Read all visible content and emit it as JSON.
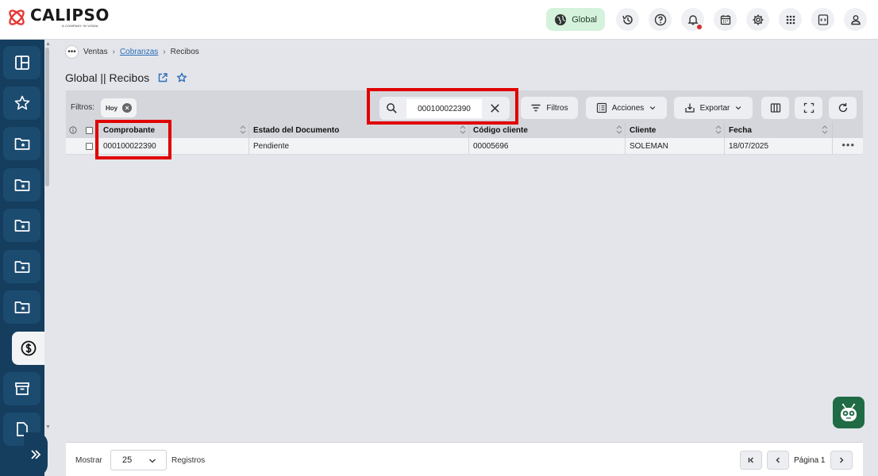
{
  "app": {
    "logo_name": "CALIPSO",
    "logo_tagline": "A COMPANY IN VISMA"
  },
  "topbar": {
    "scope_label": "Global",
    "icons": [
      "history-icon",
      "help-icon",
      "bell-icon",
      "calendar-icon",
      "gear-icon",
      "apps-grid-icon",
      "code-window-icon",
      "user-icon"
    ]
  },
  "sidebar": {
    "items": [
      "layout-icon",
      "star-icon",
      "folder-star-icon",
      "folder-star-icon",
      "folder-star-icon",
      "folder-star-icon",
      "folder-star-icon",
      "dollar-icon",
      "archive-icon",
      "document-icon"
    ],
    "active_index": 7
  },
  "breadcrumb": {
    "more": "•••",
    "items": [
      "Ventas",
      "Cobranzas",
      "Recibos"
    ]
  },
  "page": {
    "title": "Global || Recibos"
  },
  "toolbar": {
    "filters_label": "Filtros:",
    "active_chip": "Hoy",
    "search_value": "000100022390",
    "filters_button": "Filtros",
    "actions_button": "Acciones",
    "export_button": "Exportar"
  },
  "grid": {
    "columns": [
      "Comprobante",
      "Estado del Documento",
      "Código cliente",
      "Cliente",
      "Fecha"
    ],
    "rows": [
      {
        "comprobante": "000100022390",
        "estado": "Pendiente",
        "codigo_cliente": "00005696",
        "cliente": "SOLEMAN",
        "fecha": "18/07/2025"
      }
    ]
  },
  "footer": {
    "show_label": "Mostrar",
    "page_size": "25",
    "records_label": "Registros",
    "page_label": "Página 1"
  },
  "colors": {
    "sidebar_bg": "#143d5e",
    "highlight": "#e00000",
    "scope_pill": "#d5f2dc",
    "bot_button": "#1f6b45"
  }
}
